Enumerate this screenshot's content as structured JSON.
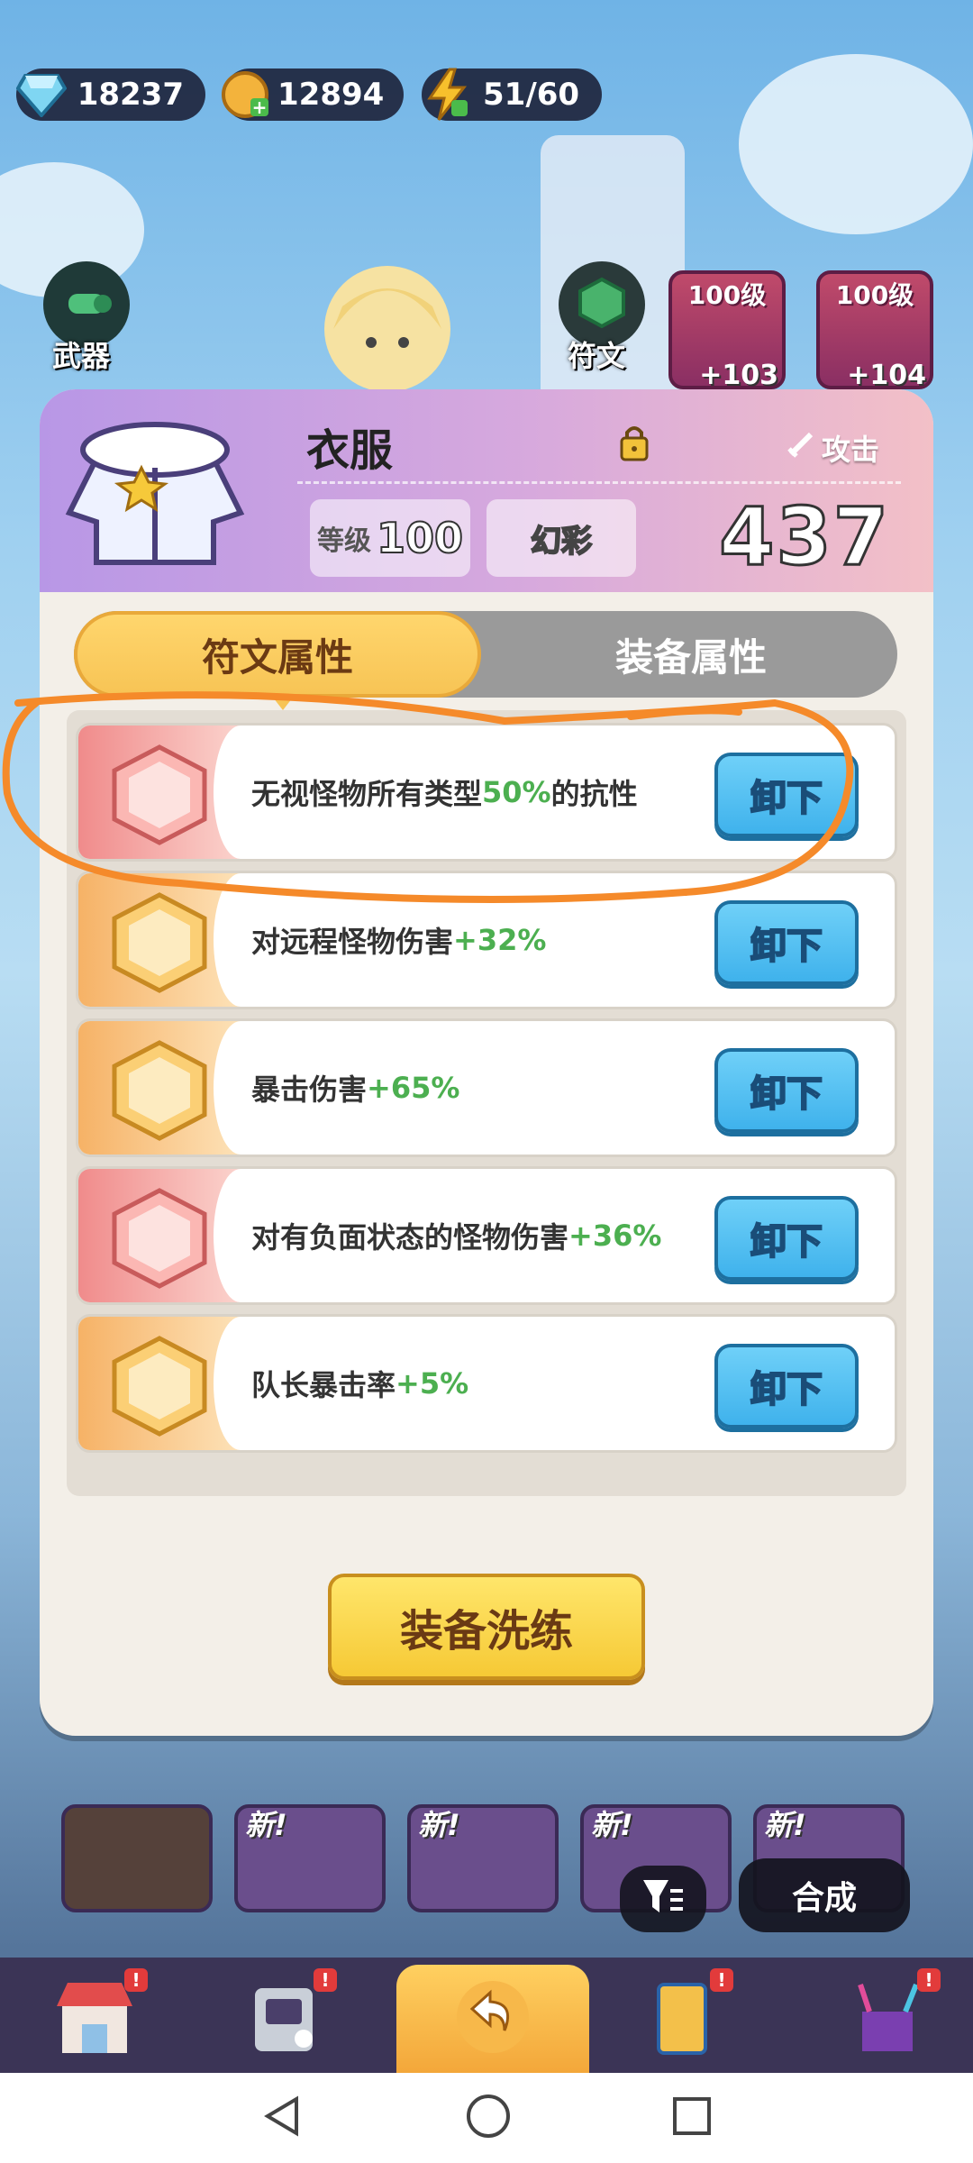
{
  "resources": {
    "gems": "18237",
    "coins": "12894",
    "energy": "51/60"
  },
  "hero_slots": {
    "weapon_label": "武器",
    "rune_label": "符文",
    "gear_cards": [
      {
        "level": "100级",
        "plus": "+103"
      },
      {
        "level": "100级",
        "plus": "+104"
      }
    ]
  },
  "item": {
    "name": "衣服",
    "stat_type": "攻击",
    "level_label": "等级",
    "level_value": "100",
    "rarity": "幻彩",
    "power": "437"
  },
  "tabs": {
    "rune_attributes": "符文属性",
    "equipment_attributes": "装备属性"
  },
  "runes": [
    {
      "text": "无视怪物所有类型",
      "bonus": "50%",
      "suffix": "的抗性",
      "button": "卸下",
      "color": "red"
    },
    {
      "text": "对远程怪物伤害",
      "bonus": "+32%",
      "suffix": "",
      "button": "卸下",
      "color": "orange"
    },
    {
      "text": "暴击伤害",
      "bonus": "+65%",
      "suffix": "",
      "button": "卸下",
      "color": "orange"
    },
    {
      "text": "对有负面状态的怪物伤害",
      "bonus": "+36%",
      "suffix": "",
      "button": "卸下",
      "color": "red"
    },
    {
      "text": "队长暴击率",
      "bonus": "+5%",
      "suffix": "",
      "button": "卸下",
      "color": "orange"
    }
  ],
  "refine_button": "装备洗练",
  "inventory": {
    "new_badge": "新!",
    "merge_button": "合成"
  },
  "colors": {
    "bonus_green": "#4caf50",
    "tab_active": "#f7c455",
    "unequip_blue": "#3fb2ec",
    "annotation_orange": "#f58a2a"
  }
}
